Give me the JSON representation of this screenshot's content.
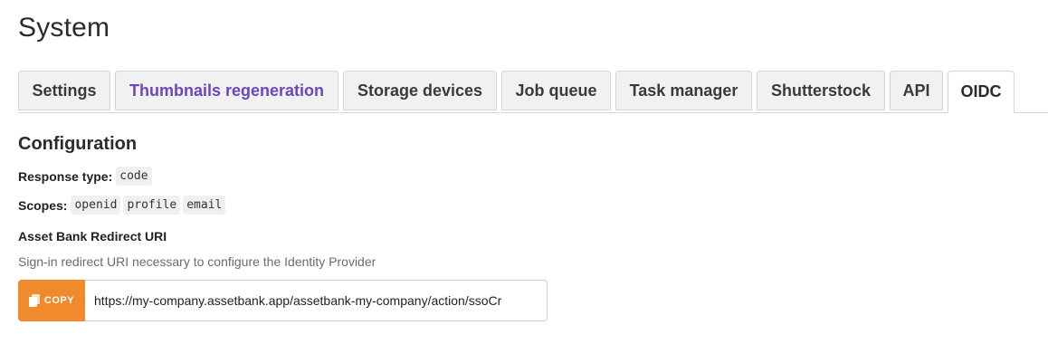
{
  "page": {
    "title": "System"
  },
  "tabs": [
    {
      "label": "Settings",
      "state": "default"
    },
    {
      "label": "Thumbnails regeneration",
      "state": "link"
    },
    {
      "label": "Storage devices",
      "state": "default"
    },
    {
      "label": "Job queue",
      "state": "default"
    },
    {
      "label": "Task manager",
      "state": "default"
    },
    {
      "label": "Shutterstock",
      "state": "default"
    },
    {
      "label": "API",
      "state": "default"
    },
    {
      "label": "OIDC",
      "state": "active"
    }
  ],
  "configuration": {
    "title": "Configuration",
    "response_type_label": "Response type:",
    "response_type_value": "code",
    "scopes_label": "Scopes:",
    "scopes": [
      "openid",
      "profile",
      "email"
    ]
  },
  "redirect": {
    "label": "Asset Bank Redirect URI",
    "helper": "Sign-in redirect URI necessary to configure the Identity Provider",
    "copy_label": "COPY",
    "copy_icon": "copy-icon",
    "uri_value": "https://my-company.assetbank.app/assetbank-my-company/action/ssoCr"
  },
  "colors": {
    "accent_orange": "#f08a2c",
    "link_purple": "#6b46c1"
  }
}
